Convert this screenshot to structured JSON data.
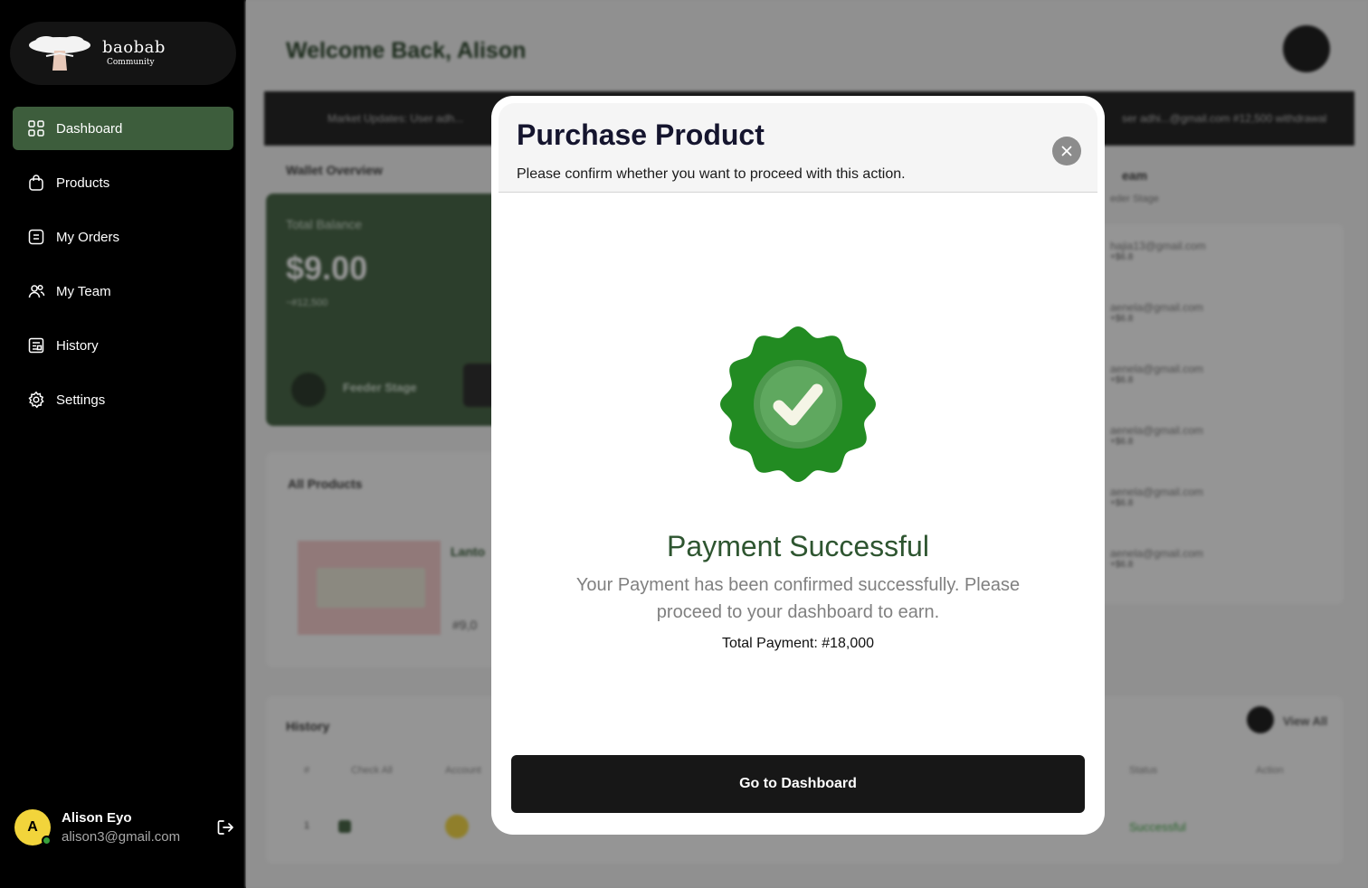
{
  "brand": {
    "name": "baobab",
    "tagline": "Community"
  },
  "sidebar": {
    "items": [
      {
        "label": "Dashboard",
        "icon": "grid-icon",
        "active": true
      },
      {
        "label": "Products",
        "icon": "bag-icon"
      },
      {
        "label": "My Orders",
        "icon": "orders-icon"
      },
      {
        "label": "My Team",
        "icon": "team-icon"
      },
      {
        "label": "History",
        "icon": "history-icon"
      },
      {
        "label": "Settings",
        "icon": "gear-icon"
      }
    ],
    "user": {
      "initial": "A",
      "name": "Alison Eyo",
      "email": "alison3@gmail.com"
    }
  },
  "background": {
    "welcome": "Welcome Back, Alison",
    "ticker_left": "Market Updates: User adh...",
    "ticker_right": "ser adhi...@gmail.com #12,500 withdrawal",
    "wallet_title": "Wallet Overview",
    "wallet_label": "Total Balance",
    "wallet_amount": "$9.00",
    "wallet_sub": "~#12,500",
    "wallet_stage": "Feeder Stage",
    "team_title": "eam",
    "team_sub": "eder Stage",
    "team": [
      {
        "email": "hajia13@gmail.com",
        "sub": "+$6.8"
      },
      {
        "email": "aenela@gmail.com",
        "sub": "+$6.8"
      },
      {
        "email": "aenela@gmail.com",
        "sub": "+$6.8"
      },
      {
        "email": "aenela@gmail.com",
        "sub": "+$6.8"
      },
      {
        "email": "aenela@gmail.com",
        "sub": "+$6.8"
      },
      {
        "email": "aenela@gmail.com",
        "sub": "+$6.8"
      }
    ],
    "products_title": "All Products",
    "product_name": "Lanto",
    "product_price": "#9,0",
    "history_title": "History",
    "view_all": "View All",
    "history_headers": [
      "#",
      "Check All",
      "Account",
      "Status",
      "Action"
    ],
    "history_row": {
      "num": "1",
      "status": "Successful"
    }
  },
  "modal": {
    "title": "Purchase Product",
    "subtitle": "Please confirm whether you want to proceed with this action.",
    "success_title": "Payment Successful",
    "success_message": "Your Payment has been confirmed successfully. Please proceed to your dashboard to earn.",
    "total_payment": "Total Payment: #18,000",
    "button_label": "Go to Dashboard"
  },
  "colors": {
    "accent": "#3d5d3c",
    "badge": "#228b22",
    "badge_inner": "#5fa85f",
    "success_text": "#2e5530"
  }
}
